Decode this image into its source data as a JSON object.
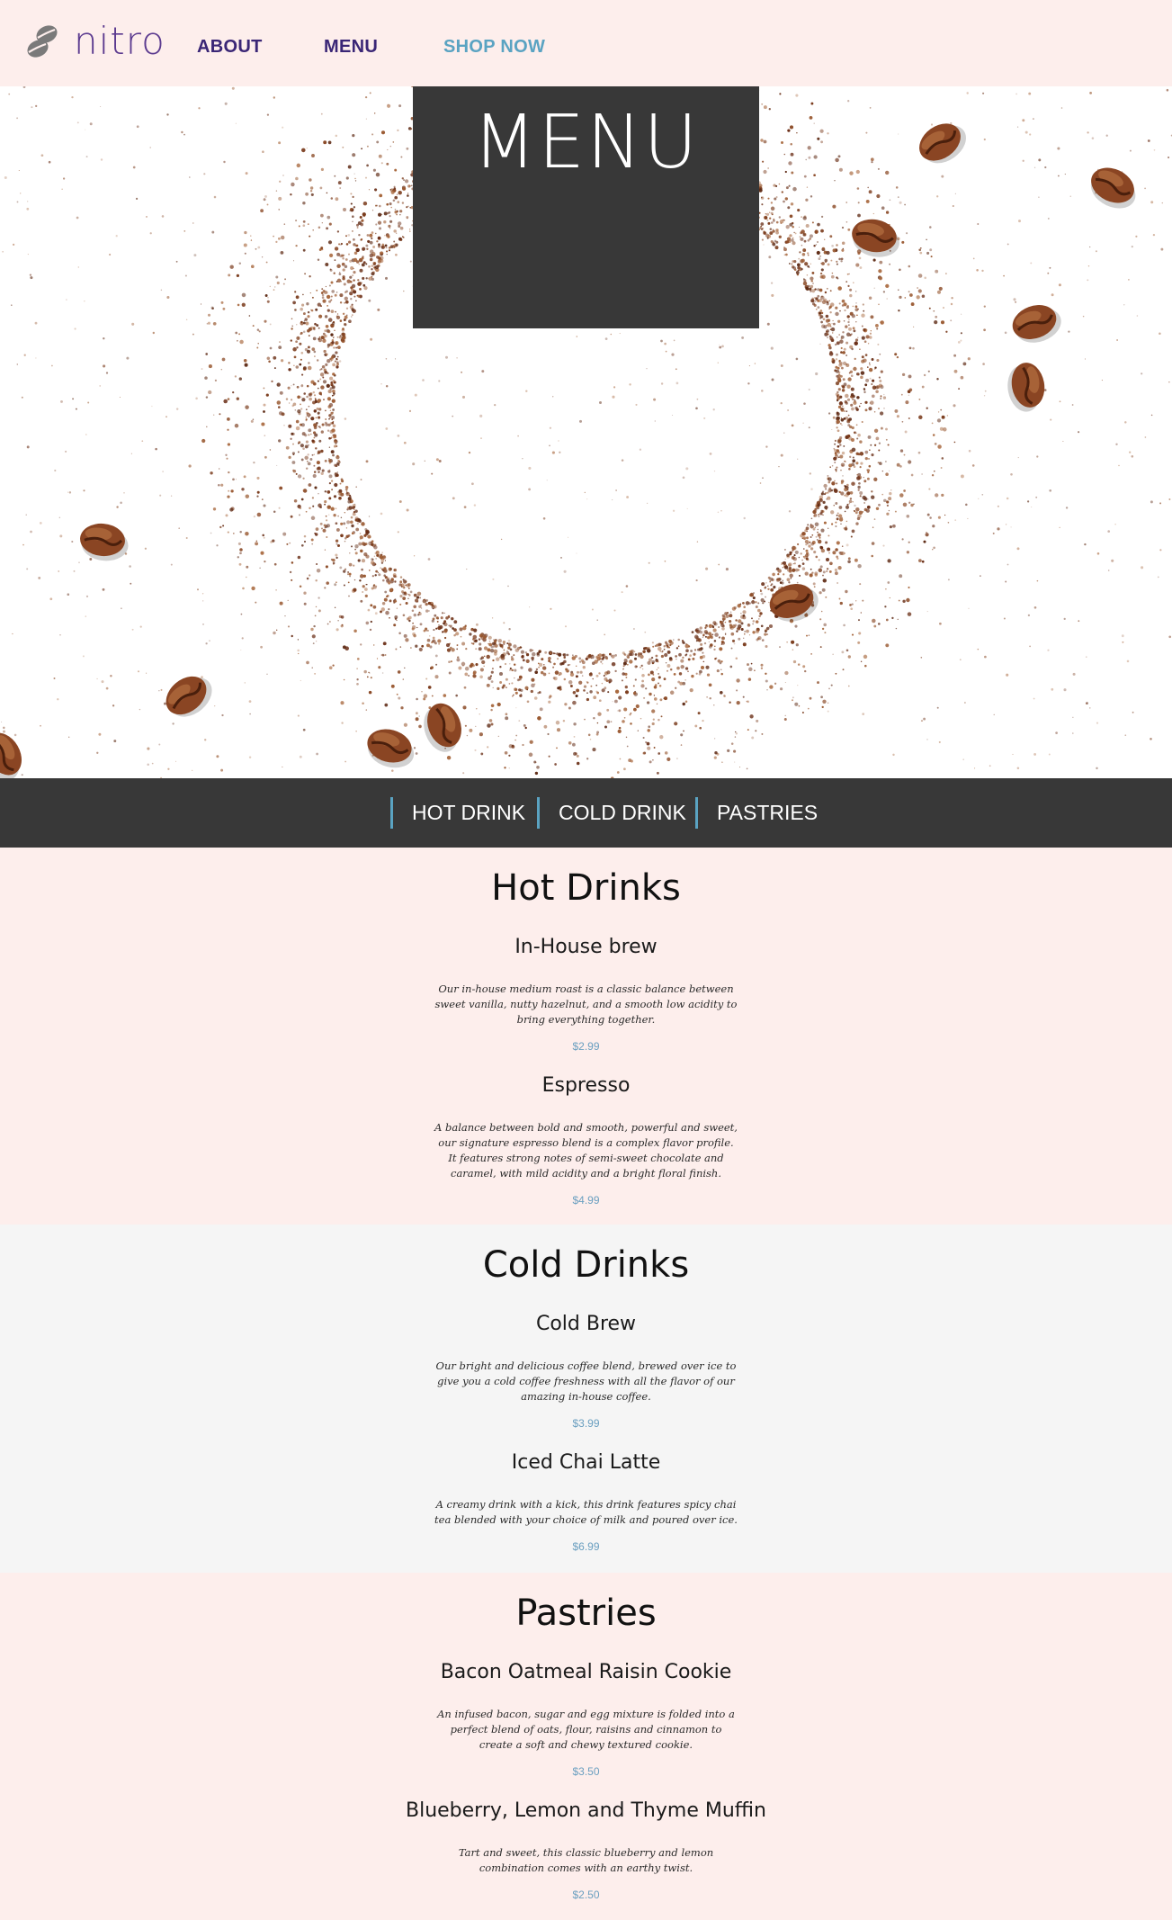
{
  "header": {
    "logo_text": "nitro",
    "logo_icon": "coffee-beans-icon",
    "nav": [
      {
        "label": "ABOUT"
      },
      {
        "label": "MENU"
      },
      {
        "label": "SHOP NOW"
      }
    ]
  },
  "hero": {
    "title": "MENU"
  },
  "categories": [
    {
      "label": "HOT DRINK"
    },
    {
      "label": "COLD DRINK"
    },
    {
      "label": "PASTRIES"
    }
  ],
  "sections": [
    {
      "title": "Hot Drinks",
      "items": [
        {
          "name": "In-House brew",
          "description": "Our in-house medium roast is a classic balance between sweet vanilla, nutty hazelnut, and a smooth low acidity to bring everything together.",
          "price": "$2.99"
        },
        {
          "name": "Espresso",
          "description": "A balance between bold and smooth, powerful and sweet, our signature espresso blend is a complex flavor profile. It features strong notes of semi-sweet chocolate and caramel, with mild acidity and a bright floral finish.",
          "price": "$4.99"
        }
      ]
    },
    {
      "title": "Cold Drinks",
      "items": [
        {
          "name": "Cold Brew",
          "description": "Our bright and delicious coffee blend, brewed over ice to give you a cold coffee freshness with all the flavor of our amazing in-house coffee.",
          "price": "$3.99"
        },
        {
          "name": "Iced Chai Latte",
          "description": "A creamy drink with a kick, this drink features spicy chai tea blended with your choice of milk and poured over ice.",
          "price": "$6.99"
        }
      ]
    },
    {
      "title": "Pastries",
      "items": [
        {
          "name": "Bacon Oatmeal Raisin Cookie",
          "description": "An infused bacon, sugar and egg mixture is folded into a perfect blend of oats, flour, raisins and cinnamon to create a soft and chewy textured cookie.",
          "price": "$3.50"
        },
        {
          "name": "Blueberry, Lemon and Thyme Muffin",
          "description": "Tart and sweet, this classic blueberry and lemon combination comes with an earthy twist.",
          "price": "$2.50"
        }
      ]
    }
  ],
  "colors": {
    "page_bg": "#fdeeec",
    "alt_bg": "#f5f5f5",
    "dark_bar": "#383838",
    "accent_blue": "#5aa3c2",
    "nav_purple": "#3a2676",
    "price_blue": "#6a9fc0"
  }
}
